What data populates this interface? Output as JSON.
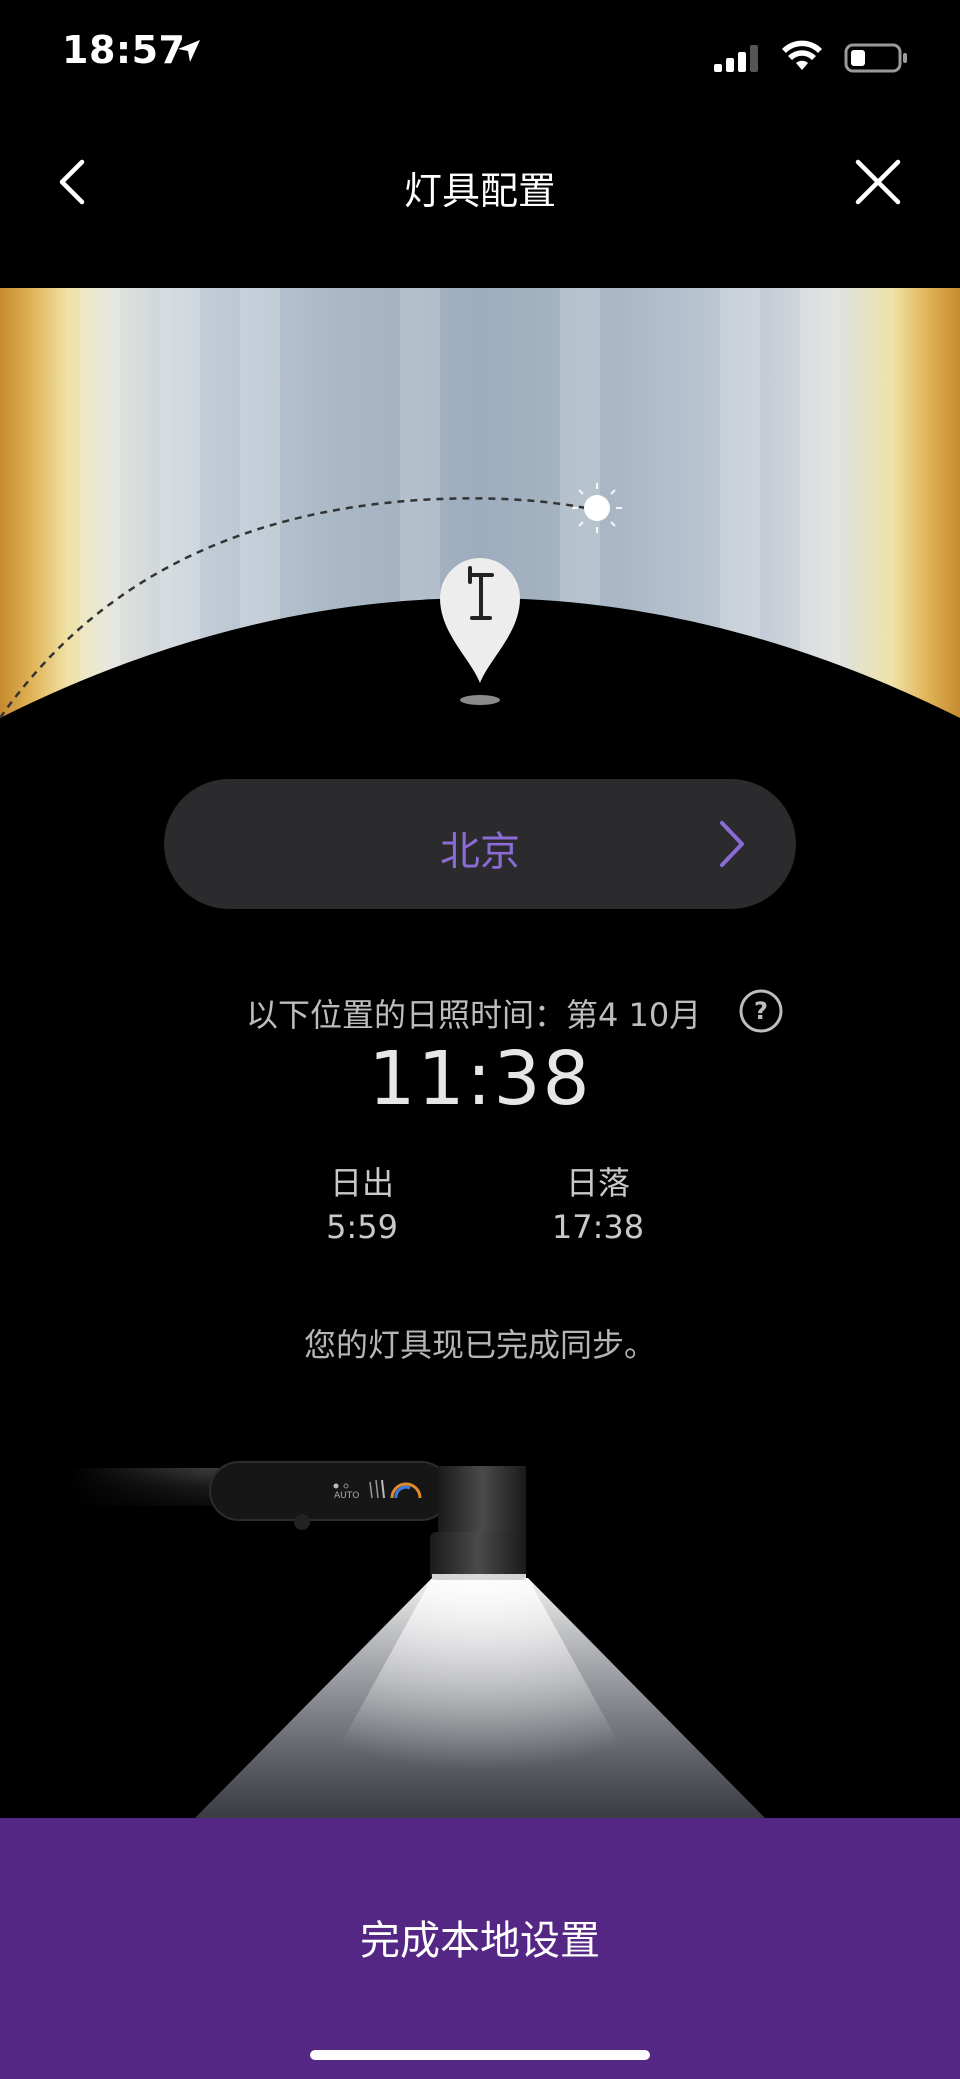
{
  "status_bar": {
    "time": "18:57"
  },
  "nav": {
    "title": "灯具配置"
  },
  "location": {
    "city": "北京"
  },
  "info": {
    "label": "以下位置的日照时间：第4 10月",
    "time": "11:38",
    "sunrise_label": "日出",
    "sunrise_time": "5:59",
    "sunset_label": "日落",
    "sunset_time": "17:38",
    "sync_status": "您的灯具现已完成同步。"
  },
  "lamp_panel": {
    "mode_label": "AUTO"
  },
  "footer": {
    "button_label": "完成本地设置"
  },
  "icons": {
    "back": "chevron-left-icon",
    "close": "close-icon",
    "city_chevron": "chevron-right-icon",
    "help": "question-circle-icon",
    "location_pin": "lamp-pin-icon",
    "sun": "sun-icon"
  },
  "colors": {
    "accent": "#8c6bd6",
    "button_bg": "#532783",
    "pill_bg": "#2b2b2d"
  }
}
